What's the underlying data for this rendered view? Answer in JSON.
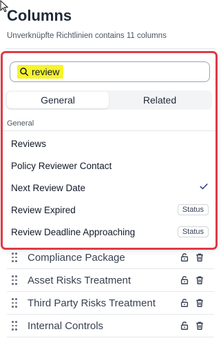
{
  "header": {
    "title": "Columns",
    "subtitle": "Unverknüpfte Richtlinien contains 11 columns"
  },
  "search": {
    "value": "review",
    "placeholder": ""
  },
  "tabs": [
    {
      "label": "General",
      "active": true
    },
    {
      "label": "Related",
      "active": false
    }
  ],
  "group": {
    "label": "General"
  },
  "options": [
    {
      "label": "Reviews",
      "checked": false,
      "badge": ""
    },
    {
      "label": "Policy Reviewer Contact",
      "checked": false,
      "badge": ""
    },
    {
      "label": "Next Review Date",
      "checked": true,
      "badge": ""
    },
    {
      "label": "Review Expired",
      "checked": false,
      "badge": "Status"
    },
    {
      "label": "Review Deadline Approaching",
      "checked": false,
      "badge": "Status"
    }
  ],
  "columns": [
    {
      "label": "Compliance Package"
    },
    {
      "label": "Asset Risks Treatment"
    },
    {
      "label": "Third Party Risks Treatment"
    },
    {
      "label": "Internal Controls"
    }
  ],
  "colors": {
    "highlight": "#f7f32b",
    "popover_border": "#e03a45",
    "check": "#3b3f8f"
  }
}
